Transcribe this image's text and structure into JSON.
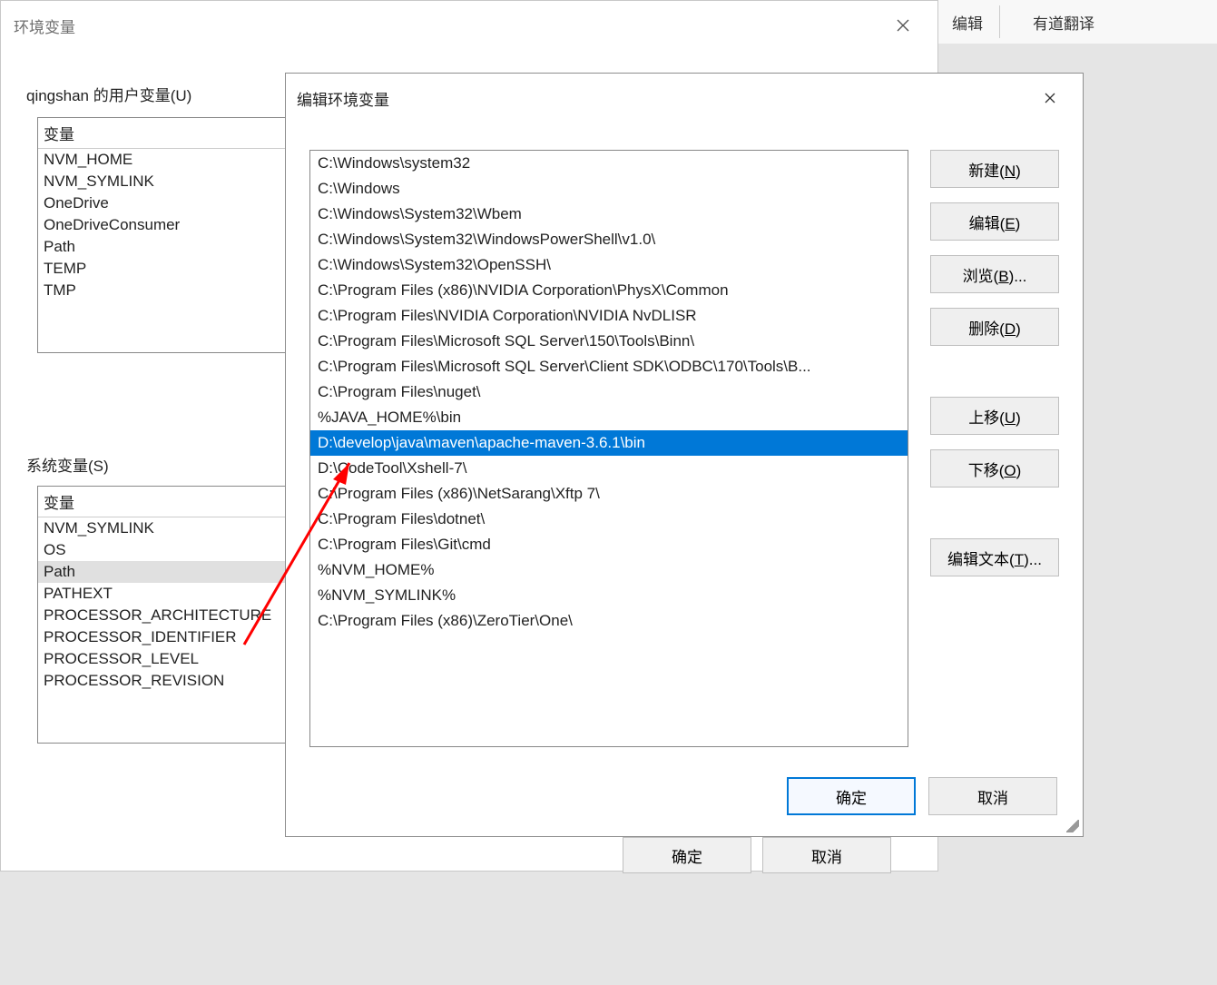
{
  "bg_menu": {
    "item1": "编辑",
    "item2": "有道翻译"
  },
  "env_dialog": {
    "title": "环境变量",
    "user_section": "qingshan 的用户变量(U)",
    "system_section": "系统变量(S)",
    "header_label": "变量",
    "user_vars": [
      "NVM_HOME",
      "NVM_SYMLINK",
      "OneDrive",
      "OneDriveConsumer",
      "Path",
      "TEMP",
      "TMP"
    ],
    "system_vars": [
      "NVM_SYMLINK",
      "OS",
      "Path",
      "PATHEXT",
      "PROCESSOR_ARCHITECTURE",
      "PROCESSOR_IDENTIFIER",
      "PROCESSOR_LEVEL",
      "PROCESSOR_REVISION"
    ],
    "system_selected_index": 2,
    "ok_label": "确定",
    "cancel_label": "取消"
  },
  "edit_dialog": {
    "title": "编辑环境变量",
    "paths": [
      "C:\\Windows\\system32",
      "C:\\Windows",
      "C:\\Windows\\System32\\Wbem",
      "C:\\Windows\\System32\\WindowsPowerShell\\v1.0\\",
      "C:\\Windows\\System32\\OpenSSH\\",
      "C:\\Program Files (x86)\\NVIDIA Corporation\\PhysX\\Common",
      "C:\\Program Files\\NVIDIA Corporation\\NVIDIA NvDLISR",
      "C:\\Program Files\\Microsoft SQL Server\\150\\Tools\\Binn\\",
      "C:\\Program Files\\Microsoft SQL Server\\Client SDK\\ODBC\\170\\Tools\\B...",
      "C:\\Program Files\\nuget\\",
      "%JAVA_HOME%\\bin",
      "D:\\develop\\java\\maven\\apache-maven-3.6.1\\bin",
      "D:\\CodeTool\\Xshell-7\\",
      "C:\\Program Files (x86)\\NetSarang\\Xftp 7\\",
      "C:\\Program Files\\dotnet\\",
      "C:\\Program Files\\Git\\cmd",
      "%NVM_HOME%",
      "%NVM_SYMLINK%",
      "C:\\Program Files (x86)\\ZeroTier\\One\\"
    ],
    "selected_index": 11,
    "buttons": {
      "new": "新建(N)",
      "edit": "编辑(E)",
      "browse": "浏览(B)...",
      "delete": "删除(D)",
      "move_up": "上移(U)",
      "move_down": "下移(O)",
      "edit_text": "编辑文本(T)..."
    },
    "ok_label": "确定",
    "cancel_label": "取消"
  }
}
